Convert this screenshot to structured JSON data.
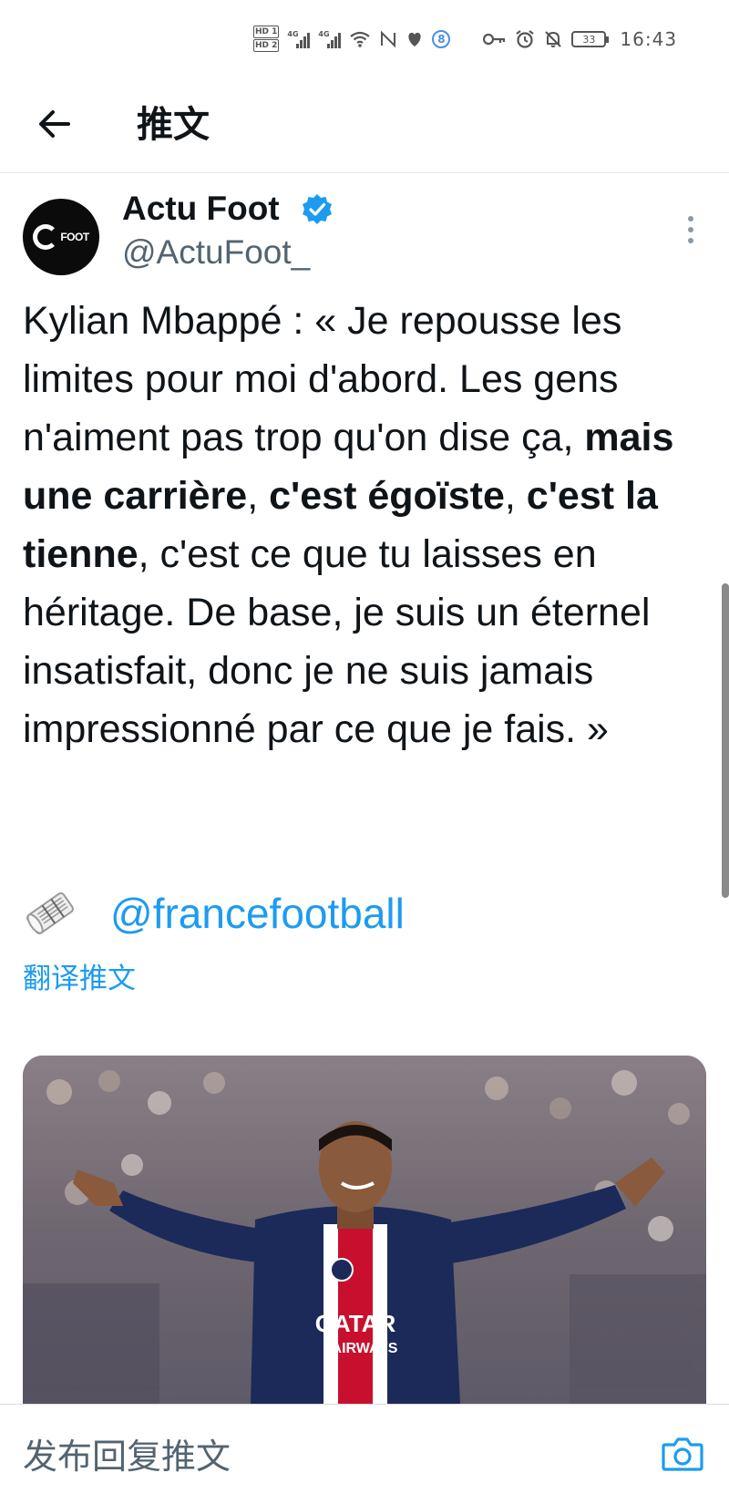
{
  "status_bar": {
    "hd1": "HD 1",
    "hd2": "HD 2",
    "net1": "4G",
    "net2": "4G",
    "badge_number": "8",
    "battery": "33",
    "time": "16:43"
  },
  "header": {
    "title": "推文"
  },
  "tweet": {
    "author_name": "Actu Foot",
    "handle": "@ActuFoot_",
    "avatar_text": "FOOT",
    "text_segments": [
      {
        "text": "Kylian Mbappé : « Je repousse les limites pour moi d'abord. Les gens n'aiment pas trop qu'on dise ça, ",
        "bold": false
      },
      {
        "text": "mais une carrière",
        "bold": true
      },
      {
        "text": ", ",
        "bold": false
      },
      {
        "text": "c'est égoïste",
        "bold": true
      },
      {
        "text": ", ",
        "bold": false
      },
      {
        "text": "c'est la tienne",
        "bold": true
      },
      {
        "text": ", c'est ce que tu laisses en héritage. De base, je suis un éternel insatisfait, donc je ne suis jamais impressionné par ce que je fais. »",
        "bold": false
      }
    ],
    "mention": "@francefootball",
    "translate_label": "翻译推文"
  },
  "media": {
    "shirt_sponsor_line1": "QATAR",
    "shirt_sponsor_line2": "AIRWAYS"
  },
  "reply": {
    "placeholder": "发布回复推文"
  },
  "colors": {
    "link_blue": "#1d9bf0",
    "text_primary": "#0f1419",
    "text_secondary": "#536471",
    "jersey_navy": "#1c2a5a"
  }
}
